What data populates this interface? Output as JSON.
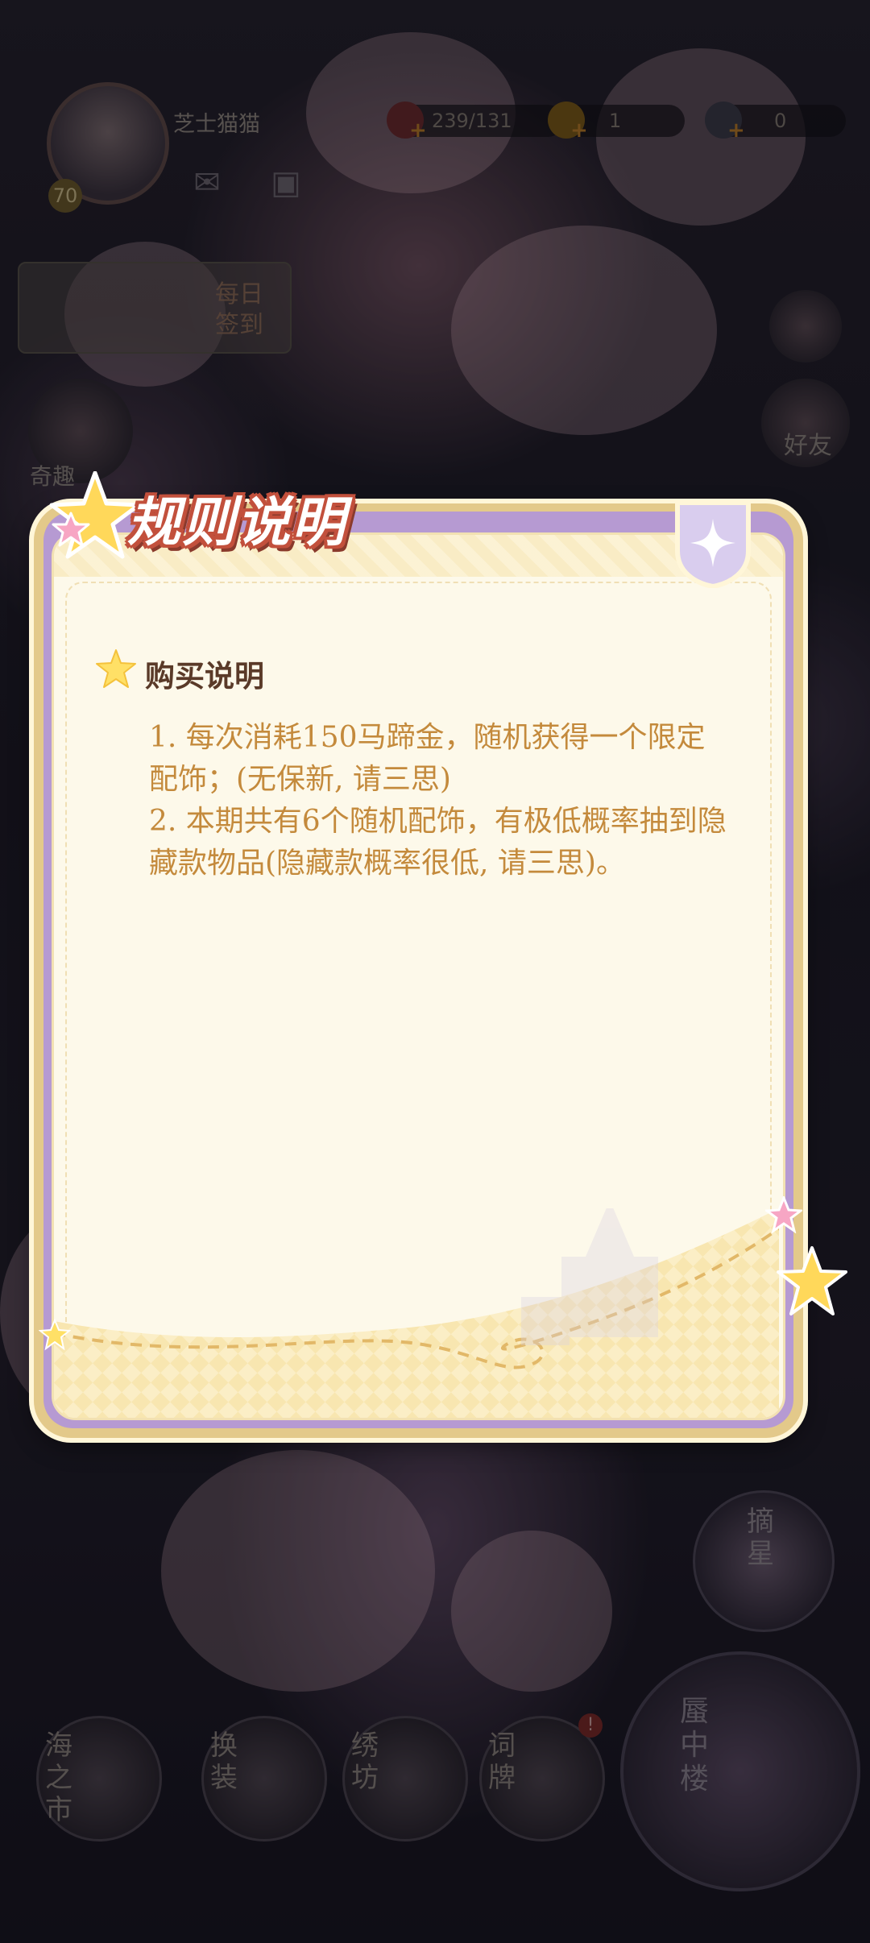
{
  "hud": {
    "username": "芝士猫猫",
    "level": "70",
    "stamina": "239/131",
    "gold": "1",
    "gems": "0"
  },
  "side": {
    "signin_label": "每日签到",
    "mystery_label": "奇趣",
    "friends_label": "好友"
  },
  "bottom_nav": {
    "sea_market": "海之市",
    "dress_up": "换装",
    "embroidery": "绣坊",
    "word_cards": "词牌",
    "pick_star": "摘星",
    "mirage": "蜃中楼"
  },
  "dialog": {
    "title": "规则说明",
    "section_title": "购买说明",
    "rules": [
      "1. 每次消耗150马蹄金，随机获得一个限定配饰；(无保新, 请三思)",
      "2. 本期共有6个随机配饰，有极低概率抽到隐藏款物品(隐藏款概率很低, 请三思)。"
    ]
  },
  "colors": {
    "title_outline": "#c2503c",
    "rule_text": "#c48a3c",
    "section_text": "#5a3a28",
    "frame_purple": "#b69ad2",
    "paper": "#fdf9ea"
  }
}
